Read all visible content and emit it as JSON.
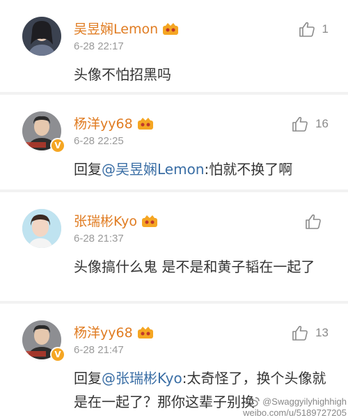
{
  "comments": [
    {
      "username": "吴昱娴Lemon",
      "time": "6-28 22:17",
      "likes": "1",
      "content_prefix": "",
      "mention": "",
      "content_rest": "头像不怕招黑吗",
      "verified": false
    },
    {
      "username": "杨洋yy68",
      "time": "6-28 22:25",
      "likes": "16",
      "content_prefix": "回复",
      "mention": "@吴昱娴Lemon",
      "content_rest": ":怕就不换了啊",
      "verified": true
    },
    {
      "username": "张瑞彬Kyo",
      "time": "6-28 21:37",
      "likes": "",
      "content_prefix": "",
      "mention": "",
      "content_rest": "头像搞什么鬼  是不是和黄子韬在一起了",
      "verified": false
    },
    {
      "username": "杨洋yy68",
      "time": "6-28 21:47",
      "likes": "13",
      "content_prefix": "回复",
      "mention": "@张瑞彬Kyo",
      "content_rest": ":太奇怪了，换个头像就是在一起了？那你这辈子别换",
      "verified": true
    }
  ],
  "watermark": {
    "handle": "@Swaggyilyhighhigh",
    "url": "weibo.com/u/5189727205"
  },
  "colors": {
    "username": "#e07c22",
    "mention": "#3a6ea5",
    "time": "#9a9a9a",
    "separator": "#f2f2f2"
  },
  "icons": {
    "like": "thumbs-up-icon",
    "vip": "vip-crown-icon",
    "verified": "verified-badge-icon"
  }
}
